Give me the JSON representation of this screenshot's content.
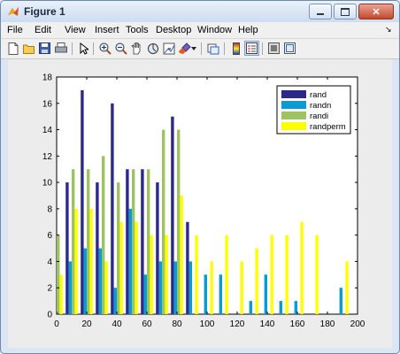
{
  "window": {
    "title": "Figure 1",
    "controls": [
      "minimize",
      "maximize",
      "close"
    ]
  },
  "menubar": {
    "items": [
      "File",
      "Edit",
      "View",
      "Insert",
      "Tools",
      "Desktop",
      "Window",
      "Help"
    ],
    "arrow": "↘"
  },
  "toolbar": {
    "buttons": [
      "new-figure-icon",
      "open-file-icon",
      "save-icon",
      "print-icon",
      "edit-plot-icon",
      "zoom-in-icon",
      "zoom-out-icon",
      "pan-icon",
      "rotate-3d-icon",
      "data-cursor-icon",
      "brush-icon",
      "brush-dropdown-icon",
      "link-plot-icon",
      "insert-colorbar-icon",
      "insert-legend-icon",
      "hide-plot-tools-icon",
      "show-plot-tools-icon"
    ]
  },
  "chart_data": {
    "type": "bar",
    "x": [
      0,
      10,
      20,
      30,
      40,
      50,
      60,
      70,
      80,
      90,
      100,
      110,
      120,
      130,
      140,
      150,
      160,
      170,
      180,
      190,
      200
    ],
    "xticks": [
      "0",
      "20",
      "40",
      "60",
      "80",
      "100",
      "120",
      "140",
      "160",
      "180",
      "200"
    ],
    "yticks": [
      "0",
      "2",
      "4",
      "6",
      "8",
      "10",
      "12",
      "14",
      "16",
      "18"
    ],
    "xlim": [
      0,
      200
    ],
    "ylim": [
      0,
      18
    ],
    "legend_position": "top-right",
    "series": [
      {
        "name": "rand",
        "color": "#2b2a8a",
        "values": [
          0,
          10,
          17,
          10,
          16,
          11,
          11,
          10,
          15,
          7,
          0,
          0,
          0,
          0,
          0,
          0,
          0,
          0,
          0,
          0,
          0
        ]
      },
      {
        "name": "randn",
        "color": "#0a9bd2",
        "values": [
          0,
          4,
          5,
          5,
          2,
          8,
          3,
          4,
          4,
          4,
          3,
          3,
          0,
          1,
          3,
          1,
          1,
          0,
          0,
          2,
          0
        ]
      },
      {
        "name": "randi",
        "color": "#9fc363",
        "values": [
          6,
          11,
          11,
          12,
          10,
          11,
          11,
          14,
          14,
          0,
          0,
          0,
          0,
          0,
          0,
          0,
          0,
          0,
          0,
          0,
          0
        ]
      },
      {
        "name": "randperm",
        "color": "#ffff00",
        "values": [
          3,
          8,
          8,
          4,
          7,
          7,
          6,
          6,
          9,
          6,
          4,
          6,
          4,
          5,
          6,
          6,
          7,
          6,
          0,
          4,
          0
        ]
      }
    ]
  }
}
